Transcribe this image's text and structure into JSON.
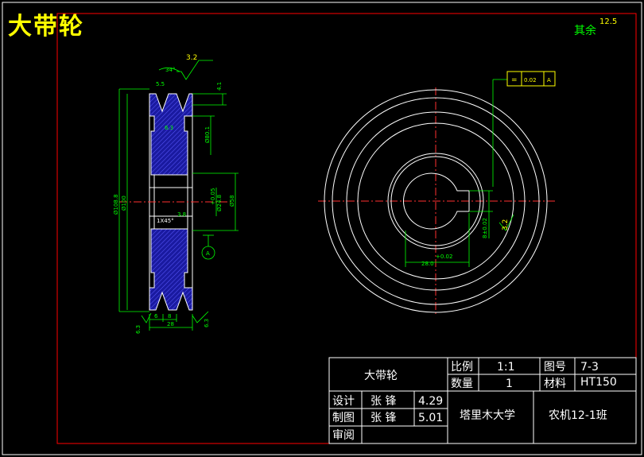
{
  "title": "大带轮",
  "surface_finish": {
    "label": "其余",
    "value": "12.5"
  },
  "side_view": {
    "roughness_top": "3.2",
    "angle": "34°",
    "dim_groove_top": "5.5",
    "dim_right_top": "4.1",
    "dim_groove_mid": "6.3",
    "dim_right_mid": "Ø80.1",
    "dim_outer_dia": "Ø108.8",
    "dim_pitch_dia": "Ø100",
    "dim_bore": "Ø24.8",
    "dim_bore_tol": "+0.05",
    "dim_hub": "Ø58",
    "chamfer": "1X45°",
    "dim_hub_width": "3.8",
    "datum": "A",
    "roughness_bottom_left": "6.3",
    "roughness_bottom_right": "6.3",
    "dim_b1": "6",
    "dim_b2": "8",
    "dim_width": "28"
  },
  "front_view": {
    "tolerance_symbol": "=",
    "tolerance_value": "0.02",
    "tolerance_datum": "A",
    "keyway_depth": "8±0.02",
    "roughness_keyway": "3.2",
    "keyway_tol": "+0.02",
    "keyway_width": "28.0"
  },
  "title_block": {
    "part_name": "大带轮",
    "scale_label": "比例",
    "scale_value": "1:1",
    "drawing_no_label": "图号",
    "drawing_no_value": "7-3",
    "qty_label": "数量",
    "qty_value": "1",
    "material_label": "材料",
    "material_value": "HT150",
    "design_label": "设计",
    "design_name": "张 锋",
    "design_date": "4.29",
    "draw_label": "制图",
    "draw_name": "张 锋",
    "draw_date": "5.01",
    "review_label": "审阅",
    "school": "塔里木大学",
    "class": "农机12-1班"
  },
  "colors": {
    "background": "#000000",
    "frame": "#ff0000",
    "outline": "#ffffff",
    "dimension": "#00ff00",
    "hatch": "#3030ff",
    "title": "#ffff00",
    "tolerance": "#ffff00"
  }
}
